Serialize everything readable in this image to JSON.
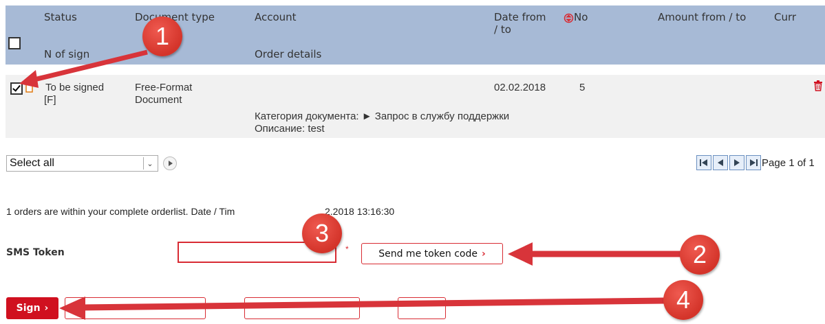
{
  "table": {
    "headers": {
      "status": "Status",
      "n_of_sign": "N of sign",
      "document_type": "Document type",
      "account": "Account",
      "order_details": "Order details",
      "date_from_to": "Date from",
      "date_from_to_2": "/ to",
      "no": "No",
      "amount_from_to": "Amount from / to",
      "curr": "Curr"
    },
    "row": {
      "checked": true,
      "status_line1": "To be signed",
      "status_line2": "[F]",
      "doc_type_line1": "Free-Format",
      "doc_type_line2": "Document",
      "date": "02.02.2018",
      "no": "5",
      "detail_line1": "Категория документа: ► Запрос в службу поддержки",
      "detail_line2": "Описание: test"
    }
  },
  "select_all": {
    "label": "Select all"
  },
  "pager": {
    "text": "Page 1 of 1"
  },
  "summary": {
    "text_before": "1 orders are within your complete orderlist. Date / Tim",
    "text_after": "2.2018 13:16:30"
  },
  "sms": {
    "label": "SMS Token",
    "value": "",
    "required_mark": "*",
    "send_button": "Send me token code"
  },
  "actions": {
    "sign": "Sign",
    "delete_selected": "",
    "decline_selected": "",
    "print": ""
  },
  "callouts": [
    "1",
    "2",
    "3",
    "4"
  ],
  "colors": {
    "header_bg": "#a7bad6",
    "row_bg": "#f1f1f1",
    "accent_red": "#d0101f",
    "callout_red": "#d4342a"
  }
}
